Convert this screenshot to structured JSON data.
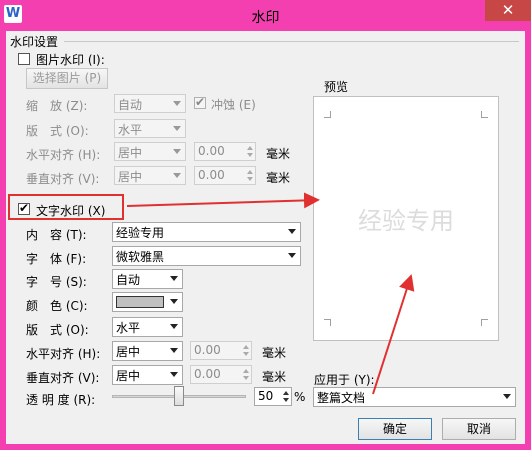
{
  "window": {
    "title": "水印",
    "app_icon": "W",
    "close_glyph": "✕"
  },
  "watermark_settings": {
    "group_title": "水印设置"
  },
  "picture_watermark": {
    "checkbox_label": "图片水印 (I):",
    "select_picture_button": "选择图片 (P)",
    "zoom_label": "缩　放 (Z):",
    "zoom_value": "自动",
    "washout_label": "冲蚀 (E)",
    "layout_label": "版　式 (O):",
    "layout_value": "水平",
    "h_align_label": "水平对齐 (H):",
    "h_align_value": "居中",
    "h_offset": "0.00",
    "h_unit": "毫米",
    "v_align_label": "垂直对齐 (V):",
    "v_align_value": "居中",
    "v_offset": "0.00",
    "v_unit": "毫米"
  },
  "text_watermark": {
    "checkbox_label": "文字水印 (X)",
    "content_label": "内　容 (T):",
    "content_value": "经验专用",
    "font_label": "字　体 (F):",
    "font_value": "微软雅黑",
    "size_label": "字　号 (S):",
    "size_value": "自动",
    "color_label": "颜　色 (C):",
    "color_value": "#c0c0c0",
    "layout_label": "版　式 (O):",
    "layout_value": "水平",
    "h_align_label": "水平对齐 (H):",
    "h_align_value": "居中",
    "h_offset": "0.00",
    "h_unit": "毫米",
    "v_align_label": "垂直对齐 (V):",
    "v_align_value": "居中",
    "v_offset": "0.00",
    "v_unit": "毫米",
    "transparency_label": "透 明 度 (R):",
    "transparency_value": "50",
    "transparency_unit": "%",
    "transparency_level": 0.5
  },
  "preview": {
    "title": "预览",
    "watermark_text": "经验专用"
  },
  "apply_to": {
    "label": "应用于 (Y):",
    "value": "整篇文档"
  },
  "buttons": {
    "ok": "确定",
    "cancel": "取消"
  },
  "colors": {
    "title_bar": "#f33fb0",
    "close_button": "#c74646",
    "annotation_red": "#e03030",
    "preview_text": "#dcdcdc"
  }
}
